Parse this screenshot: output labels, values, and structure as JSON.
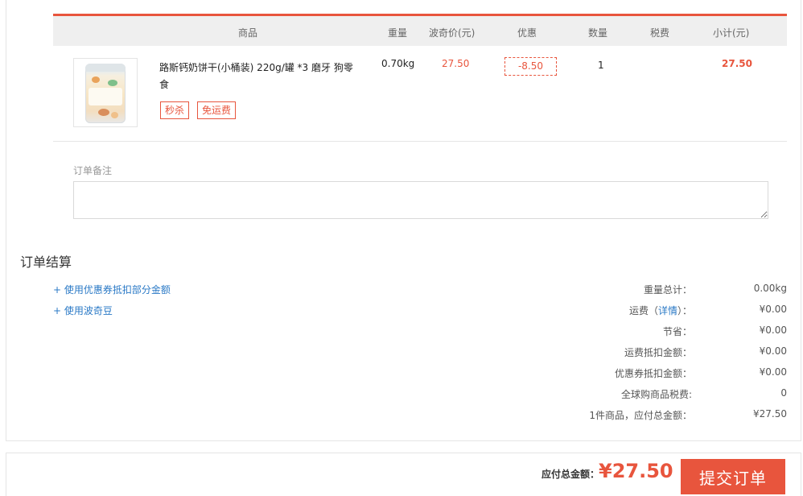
{
  "table": {
    "headers": {
      "product": "商品",
      "weight": "重量",
      "price": "波奇价(元)",
      "discount": "优惠",
      "quantity": "数量",
      "tax": "税费",
      "subtotal": "小计(元)"
    },
    "row": {
      "name": "路斯钙奶饼干(小桶装) 220g/罐 *3 磨牙 狗零食",
      "tags": [
        "秒杀",
        "免运费"
      ],
      "weight": "0.70kg",
      "price": "27.50",
      "discount": "-8.50",
      "quantity": "1",
      "tax": "",
      "subtotal": "27.50"
    }
  },
  "remark": {
    "label": "订单备注",
    "value": ""
  },
  "settlement": {
    "title": "订单结算",
    "links": {
      "coupon": "+ 使用优惠券抵扣部分金额",
      "beans": "+ 使用波奇豆"
    },
    "rows": [
      {
        "label": "重量总计：",
        "value": "0.00kg"
      },
      {
        "label_prefix": "运费（",
        "label_link": "详情",
        "label_suffix": "）：",
        "value": "¥0.00"
      },
      {
        "label": "节省：",
        "value": "¥0.00"
      },
      {
        "label": "运费抵扣金额：",
        "value": "¥0.00"
      },
      {
        "label": "优惠券抵扣金额：",
        "value": "¥0.00"
      },
      {
        "label": "全球购商品税费:",
        "value": "0"
      },
      {
        "label": "1件商品，应付总金额：",
        "value": "¥27.50"
      }
    ]
  },
  "footer": {
    "total_label": "应付总金额：",
    "total_value": "¥27.50",
    "submit_label": "提交订单"
  },
  "colors": {
    "accent": "#e8553d",
    "link": "#2a79c6"
  }
}
